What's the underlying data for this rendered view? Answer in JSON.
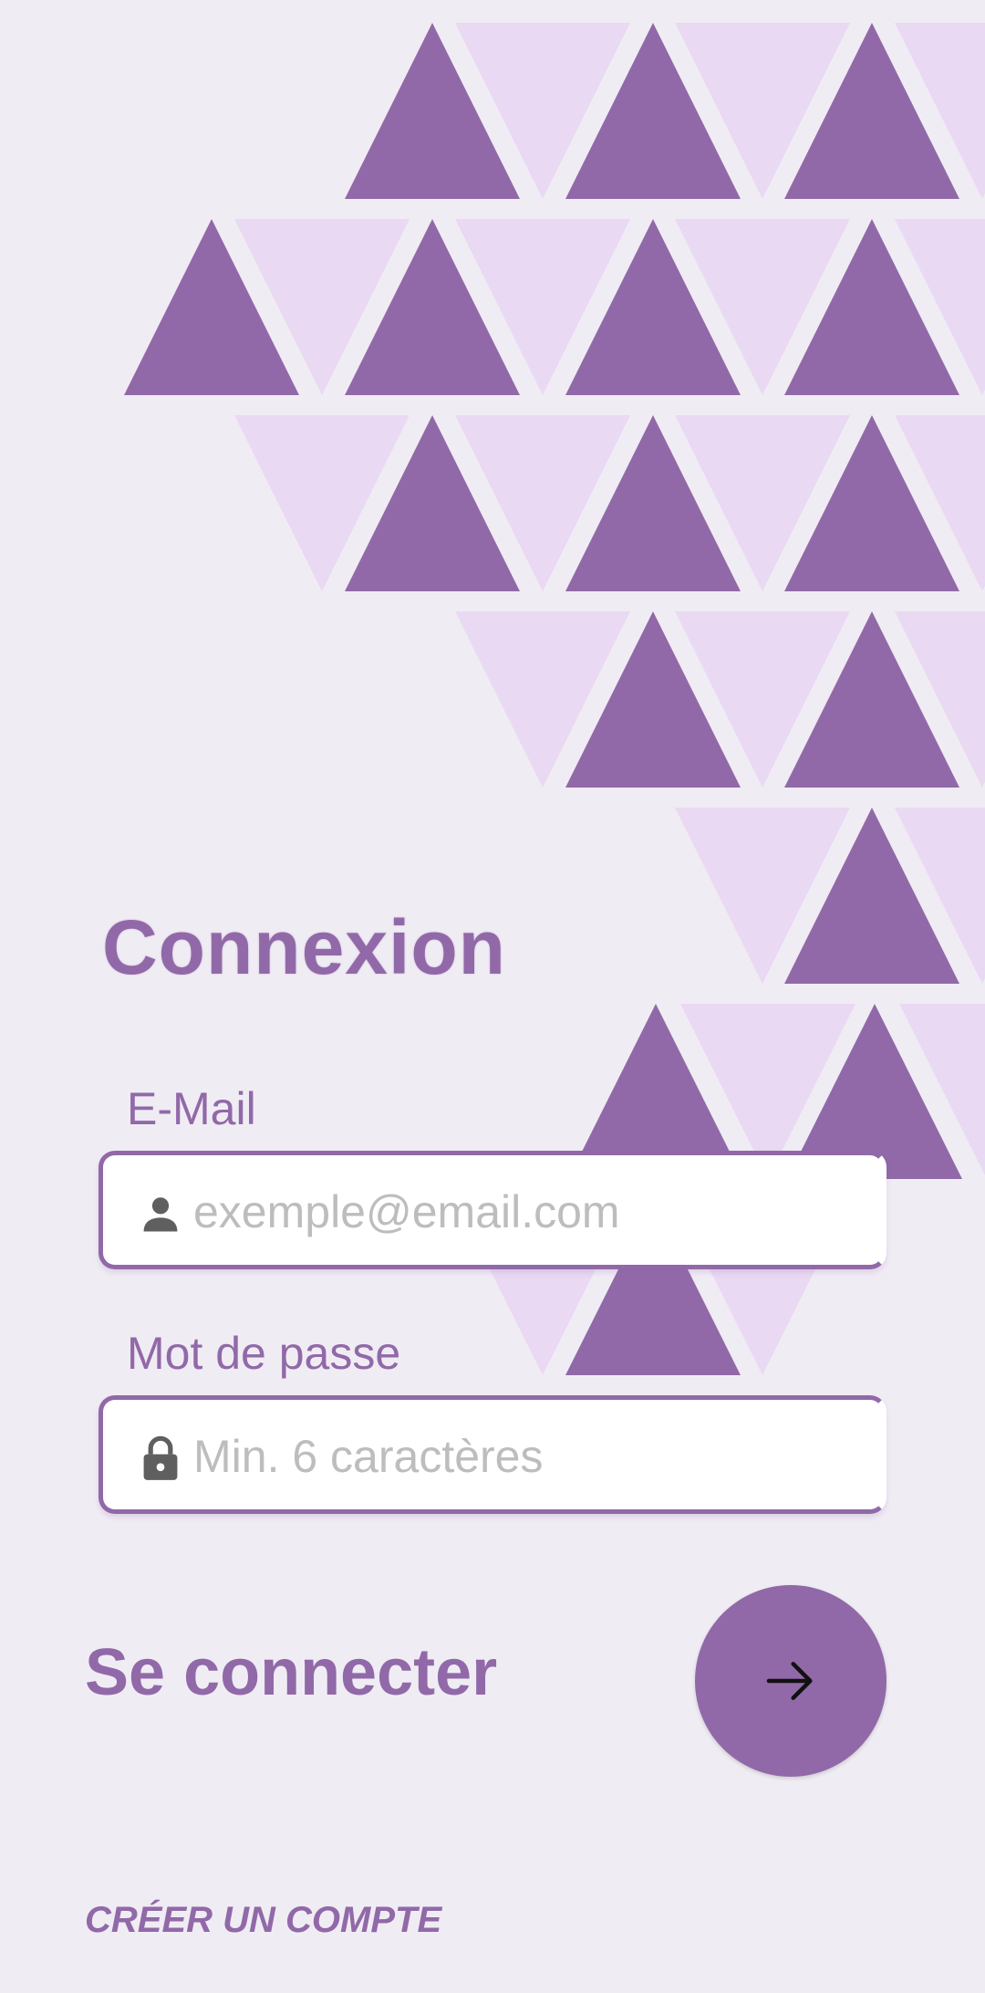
{
  "colors": {
    "accent": "#9169a8",
    "triangle_light": "#ead9f2",
    "background": "#f0ecf4"
  },
  "login": {
    "title": "Connexion",
    "email": {
      "label": "E-Mail",
      "placeholder": "exemple@email.com",
      "icon": "person-icon"
    },
    "password": {
      "label": "Mot de passe",
      "placeholder": "Min. 6 caractères",
      "icon": "lock-icon"
    },
    "submit": {
      "label": "Se connecter",
      "icon": "arrow-right-icon"
    },
    "create_account": "CRÉER UN COMPTE"
  }
}
